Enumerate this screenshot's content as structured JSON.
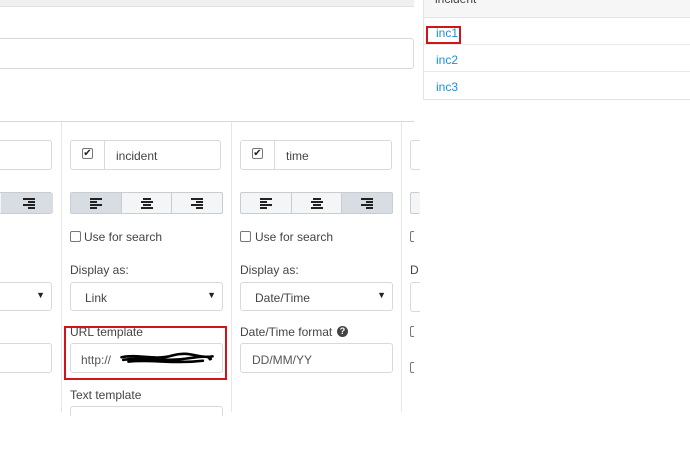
{
  "table": {
    "header": "incident",
    "rows": [
      {
        "label": "inc1"
      },
      {
        "label": "inc2"
      },
      {
        "label": "inc3"
      }
    ]
  },
  "columns": [
    {
      "name": "incident",
      "checked": true,
      "use_for_search_label": "Use for search",
      "display_as_label": "Display as:",
      "display_as_value": "Link",
      "url_template_label": "URL template",
      "url_template_value": "http://",
      "text_template_label": "Text template"
    },
    {
      "name": "time",
      "checked": true,
      "use_for_search_label": "Use for search",
      "display_as_label": "Display as:",
      "display_as_value": "Date/Time",
      "datetime_format_label": "Date/Time format",
      "datetime_format_placeholder": "DD/MM/YY"
    }
  ],
  "left_partial": {
    "display_as_caret": "▼"
  },
  "right_partial": {
    "display_as_label_fragment": "D"
  },
  "icons": {
    "checkmark": "✔",
    "caret": "▼",
    "help": "?"
  },
  "colors": {
    "link": "#1a8fd6",
    "annotation": "#d0141b"
  }
}
